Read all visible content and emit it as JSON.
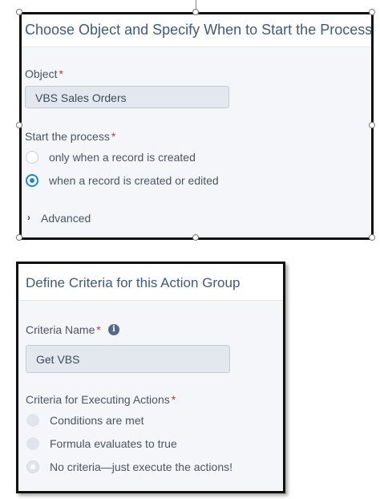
{
  "process_panel": {
    "title": "Choose Object and Specify When to Start the Process",
    "object_label": "Object",
    "required_mark": "*",
    "object_value": "VBS Sales Orders",
    "start_label": "Start the process",
    "options": [
      {
        "label": "only when a record is created",
        "selected": false
      },
      {
        "label": "when a record is created or edited",
        "selected": true
      }
    ],
    "advanced_label": "Advanced"
  },
  "criteria_panel": {
    "title": "Define Criteria for this Action Group",
    "name_label": "Criteria Name",
    "required_mark": "*",
    "name_value": "Get VBS",
    "info_icon": "i",
    "executing_label": "Criteria for Executing Actions",
    "options": [
      {
        "label": "Conditions are met",
        "selected": false
      },
      {
        "label": "Formula evaluates to true",
        "selected": false
      },
      {
        "label": "No criteria—just execute the actions!",
        "selected": true
      }
    ]
  }
}
